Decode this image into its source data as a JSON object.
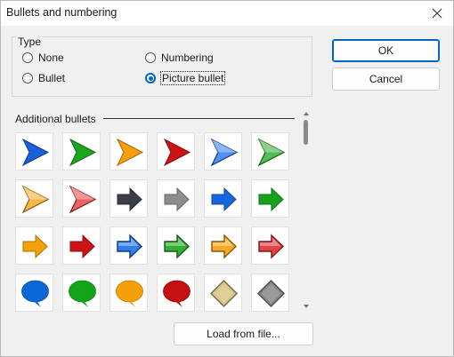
{
  "dialog": {
    "title": "Bullets and numbering"
  },
  "type_group": {
    "label": "Type",
    "options": [
      {
        "label": "None",
        "selected": false
      },
      {
        "label": "Numbering",
        "selected": false
      },
      {
        "label": "Bullet",
        "selected": false
      },
      {
        "label": "Picture bullet",
        "selected": true
      }
    ]
  },
  "buttons": {
    "ok": "OK",
    "cancel": "Cancel",
    "load": "Load from file..."
  },
  "additional": {
    "label": "Additional bullets",
    "bullets": [
      {
        "shape": "pointer",
        "color": "#1a5fd6"
      },
      {
        "shape": "pointer",
        "color": "#1ea51e"
      },
      {
        "shape": "pointer",
        "color": "#f5a00b"
      },
      {
        "shape": "pointer",
        "color": "#cc1414"
      },
      {
        "shape": "pointer3d",
        "color": "#1a6ee8"
      },
      {
        "shape": "pointer3d",
        "color": "#1ea51e"
      },
      {
        "shape": "pointer3d",
        "color": "#f5a00b"
      },
      {
        "shape": "pointer3d",
        "color": "#e03030"
      },
      {
        "shape": "arrow",
        "color": "#3a3f47"
      },
      {
        "shape": "arrow",
        "color": "#8d8d8d"
      },
      {
        "shape": "arrow",
        "color": "#1565e0"
      },
      {
        "shape": "arrow",
        "color": "#17a11e"
      },
      {
        "shape": "arrow",
        "color": "#f5a00b"
      },
      {
        "shape": "arrow",
        "color": "#cc1414"
      },
      {
        "shape": "arrow3d",
        "color": "#1a6ee8"
      },
      {
        "shape": "arrow3d",
        "color": "#1ea51e"
      },
      {
        "shape": "arrow3d",
        "color": "#f5a00b"
      },
      {
        "shape": "arrow3d",
        "color": "#e03030"
      },
      {
        "shape": "bubble",
        "color": "#0b66d8"
      },
      {
        "shape": "bubble",
        "color": "#12a51a"
      },
      {
        "shape": "bubble",
        "color": "#f5a00b"
      },
      {
        "shape": "bubble",
        "color": "#c41010"
      },
      {
        "shape": "diamond",
        "color": "#d9c58a"
      },
      {
        "shape": "diamond",
        "color": "#8a8a8a"
      }
    ]
  }
}
